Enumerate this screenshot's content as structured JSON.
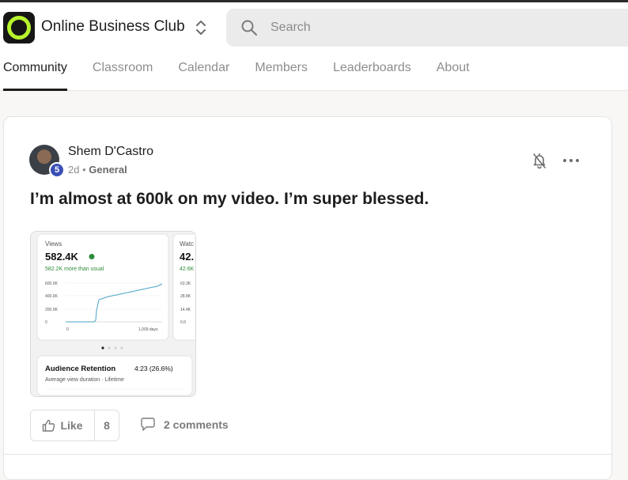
{
  "header": {
    "group_name": "Online Business Club",
    "search_placeholder": "Search"
  },
  "tabs": [
    {
      "label": "Community",
      "active": true
    },
    {
      "label": "Classroom",
      "active": false
    },
    {
      "label": "Calendar",
      "active": false
    },
    {
      "label": "Members",
      "active": false
    },
    {
      "label": "Leaderboards",
      "active": false
    },
    {
      "label": "About",
      "active": false
    }
  ],
  "post": {
    "author": "Shem D'Castro",
    "level": "5",
    "age": "2d",
    "separator": "•",
    "category": "General",
    "title": "I’m almost at 600k on my video. I’m super blessed.",
    "like_label": "Like",
    "like_count": "8",
    "comments_label": "2 comments"
  },
  "thumbnail": {
    "views_label": "Views",
    "views_value": "582.4K",
    "views_delta": "582.2K more than usual",
    "y_ticks": [
      "600.0K",
      "400.0K",
      "200.0K",
      "0"
    ],
    "x_start": "0",
    "x_end": "1,009 days",
    "watch_label": "Watc",
    "watch_value": "42.",
    "watch_delta": "42.6K",
    "watch_ticks": [
      "63.3K",
      "28.8K",
      "14.4K",
      "0.0"
    ],
    "retention_label": "Audience Retention",
    "retention_value": "4:23 (26.6%)",
    "retention_sub": "Average view duration · Lifetime"
  },
  "colors": {
    "brand_ring": "#b6f32d",
    "level_badge": "#3a4fb5",
    "chart_line": "#4aa3c7",
    "positive": "#2e8b3a"
  },
  "icons": {
    "search": "search-icon",
    "switcher": "chevron-up-down-icon",
    "bell": "bell-off-icon",
    "more": "more-horizontal-icon",
    "like": "thumbs-up-icon",
    "comment": "comment-icon"
  }
}
